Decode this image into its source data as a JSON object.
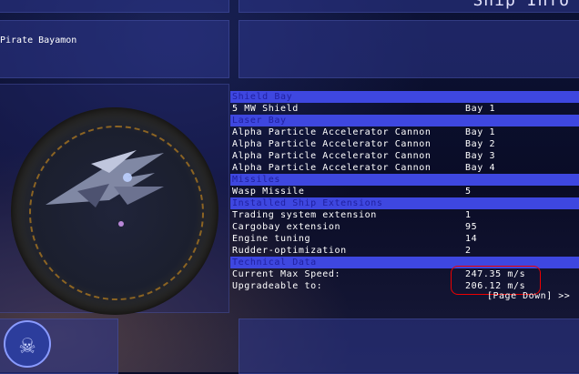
{
  "title": "Ship Info",
  "ship_name": "Pirate Bayamon",
  "page_down": "[Page Down] >>",
  "sections": {
    "shield_bay": {
      "header": "Shield Bay",
      "rows": [
        {
          "item": "5 MW Shield",
          "value": "Bay 1"
        }
      ]
    },
    "laser_bay": {
      "header": "Laser Bay",
      "rows": [
        {
          "item": "Alpha Particle Accelerator Cannon",
          "value": "Bay 1"
        },
        {
          "item": "Alpha Particle Accelerator Cannon",
          "value": "Bay 2"
        },
        {
          "item": "Alpha Particle Accelerator Cannon",
          "value": "Bay 3"
        },
        {
          "item": "Alpha Particle Accelerator Cannon",
          "value": "Bay 4"
        }
      ]
    },
    "missiles": {
      "header": "Missiles",
      "rows": [
        {
          "item": "Wasp Missile",
          "value": "5"
        }
      ]
    },
    "extensions": {
      "header": "Installed Ship Extensions",
      "rows": [
        {
          "item": "Trading system extension",
          "value": "1"
        },
        {
          "item": "Cargobay extension",
          "value": "95"
        },
        {
          "item": "Engine tuning",
          "value": "14"
        },
        {
          "item": "Rudder-optimization",
          "value": "2"
        }
      ]
    },
    "technical": {
      "header": "Technical Data",
      "rows": [
        {
          "item": "Current Max Speed:",
          "value": "247.35 m/s"
        },
        {
          "item": "Upgradeable to:",
          "value": "206.12 m/s"
        }
      ]
    }
  },
  "icons": {
    "emblem": "pirate-faction-icon"
  }
}
